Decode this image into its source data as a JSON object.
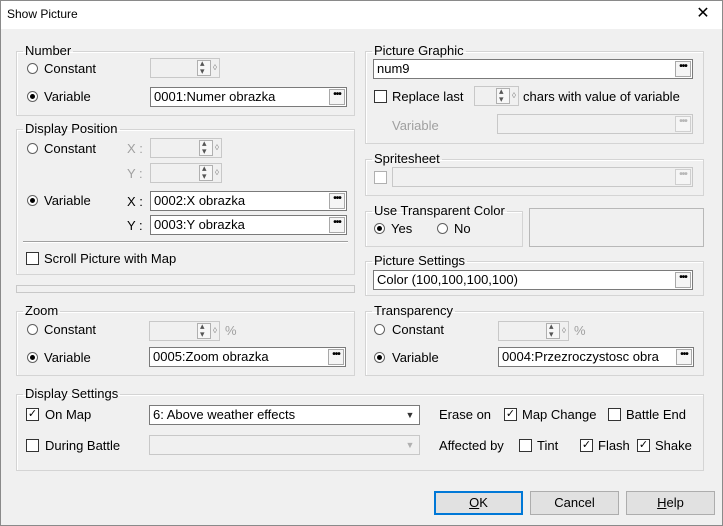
{
  "window": {
    "title": "Show Picture",
    "close_glyph": "✕"
  },
  "number": {
    "legend": "Number",
    "constant_label": "Constant",
    "variable_label": "Variable",
    "variable_value": "0001:Numer obrazka",
    "selected": "variable"
  },
  "display_position": {
    "legend": "Display Position",
    "constant_label": "Constant",
    "variable_label": "Variable",
    "x_label": "X :",
    "y_label": "Y :",
    "x_value": "0002:X obrazka",
    "y_value": "0003:Y obrazka",
    "scroll_label": "Scroll Picture with Map",
    "selected": "variable"
  },
  "zoom": {
    "legend": "Zoom",
    "constant_label": "Constant",
    "variable_label": "Variable",
    "percent": "%",
    "variable_value": "0005:Zoom obrazka",
    "selected": "variable"
  },
  "picture_graphic": {
    "legend": "Picture Graphic",
    "value": "num9",
    "replace_label": "Replace last",
    "chars_label": "chars with value of variable",
    "variable_label": "Variable"
  },
  "spritesheet": {
    "legend": "Spritesheet"
  },
  "transparent_color": {
    "legend": "Use Transparent Color",
    "yes_label": "Yes",
    "no_label": "No",
    "selected": "yes"
  },
  "picture_settings": {
    "legend": "Picture Settings",
    "value": "Color (100,100,100,100)"
  },
  "transparency": {
    "legend": "Transparency",
    "constant_label": "Constant",
    "variable_label": "Variable",
    "percent": "%",
    "variable_value": "0004:Przezroczystosc obra",
    "selected": "variable"
  },
  "display_settings": {
    "legend": "Display Settings",
    "on_map_label": "On Map",
    "on_map_checked": true,
    "layer_value": "6: Above weather effects",
    "during_battle_label": "During Battle",
    "erase_on_label": "Erase on",
    "map_change_label": "Map Change",
    "map_change_checked": true,
    "battle_end_label": "Battle End",
    "battle_end_checked": false,
    "affected_by_label": "Affected by",
    "tint_label": "Tint",
    "tint_checked": false,
    "flash_label": "Flash",
    "flash_checked": true,
    "shake_label": "Shake",
    "shake_checked": true
  },
  "buttons": {
    "ok": "OK",
    "cancel": "Cancel",
    "help": "Help"
  },
  "glyphs": {
    "check": "✓",
    "dots": "•••",
    "dropdown": "▼"
  },
  "colors": {
    "default_button_border": "#0078d7",
    "window_bg": "#f0f0f0"
  }
}
